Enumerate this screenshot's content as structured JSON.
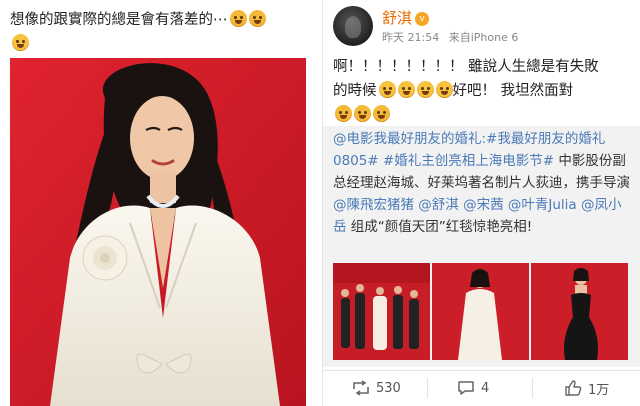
{
  "left": {
    "caption": "想像的跟實際的總是會有落差的⋯"
  },
  "post": {
    "username": "舒淇",
    "vip_badge": "v",
    "time": "昨天 21:54",
    "source": "来自iPhone 6",
    "text_line1": "啊！！！！！！！！ 雖說人生總是有失敗",
    "text_line2a": "的時候",
    "text_line2b": "好吧！ 我坦然面對"
  },
  "retweet": {
    "link1": "@电影我最好朋友的婚礼",
    "link2": ":#我最好朋友的婚礼0805#",
    "link3": " #婚礼主创亮相上海电影节#",
    "text1": " 中影股份副总经理赵海城、好莱坞著名制片人荻迪，携手导演",
    "link4": "@陳飛宏猪猪",
    "link5": " @舒淇",
    "link6": " @宋茜",
    "link7": " @叶青Julia",
    "link8": " @凤小岳",
    "text2": " 组成“颜值天团”红毯惊艳亮相!"
  },
  "actions": {
    "repost_count": "530",
    "comment_count": "4",
    "like_count": "1万"
  },
  "colors": {
    "link": "#4b7ab8",
    "username": "#e86c00",
    "red_carpet": "#d91f2b"
  },
  "icons": [
    "emoji-tears-icon",
    "emoji-cry-icon",
    "vip-badge-icon",
    "repost-icon",
    "comment-icon",
    "like-icon"
  ]
}
